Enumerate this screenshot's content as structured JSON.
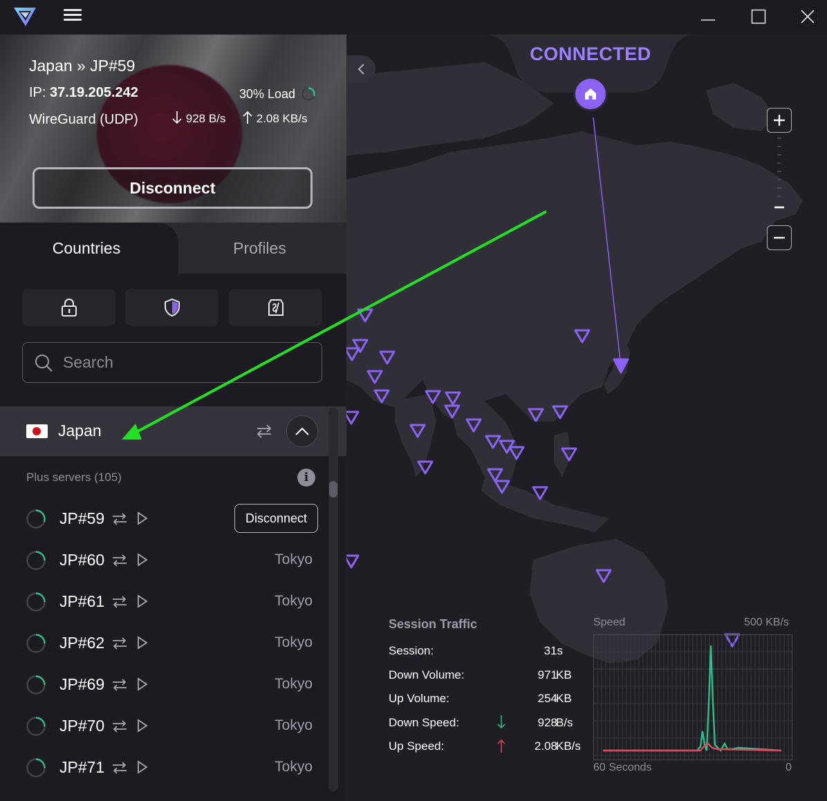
{
  "header": {
    "menu_icon": "hamburger-menu-icon",
    "window_controls": [
      "minimize",
      "maximize",
      "close"
    ]
  },
  "connection": {
    "title": "Japan » JP#59",
    "ip_label": "IP:",
    "ip_value": "37.19.205.242",
    "load": "30% Load",
    "protocol": "WireGuard (UDP)",
    "down_speed": "928 B/s",
    "up_speed": "2.08 KB/s",
    "disconnect_label": "Disconnect"
  },
  "tabs": {
    "countries": "Countries",
    "profiles": "Profiles"
  },
  "filters": [
    "lock-icon",
    "shield-icon",
    "tor-icon"
  ],
  "search": {
    "placeholder": "Search"
  },
  "country": {
    "name": "Japan",
    "plus_servers": "Plus servers (105)"
  },
  "servers": [
    {
      "name": "JP#59",
      "city": "",
      "connected": true,
      "action": "Disconnect",
      "load": 0.3
    },
    {
      "name": "JP#60",
      "city": "Tokyo",
      "load": 0.25
    },
    {
      "name": "JP#61",
      "city": "Tokyo",
      "load": 0.25
    },
    {
      "name": "JP#62",
      "city": "Tokyo",
      "load": 0.25
    },
    {
      "name": "JP#69",
      "city": "Tokyo",
      "load": 0.25
    },
    {
      "name": "JP#70",
      "city": "Tokyo",
      "load": 0.25
    },
    {
      "name": "JP#71",
      "city": "Tokyo",
      "load": 0.25
    }
  ],
  "map": {
    "status": "CONNECTED",
    "accent": "#9d80ff"
  },
  "session_traffic": {
    "title": "Session Traffic",
    "session_label": "Session:",
    "session_value": "31s",
    "down_volume_label": "Down Volume:",
    "down_volume_value": "971",
    "down_volume_unit": "KB",
    "up_volume_label": "Up Volume:",
    "up_volume_value": "254",
    "up_volume_unit": "KB",
    "down_speed_label": "Down Speed:",
    "down_speed_value": "928",
    "down_speed_unit": "B/s",
    "up_speed_label": "Up Speed:",
    "up_speed_value": "2.08",
    "up_speed_unit": "KB/s"
  },
  "speed_graph": {
    "label": "Speed",
    "max": "500  KB/s",
    "x_start": "60 Seconds",
    "x_end": "0",
    "download_color": "#2ebf8a",
    "upload_color": "#e0455c"
  },
  "annotation": {
    "arrow_color": "#22e022"
  }
}
